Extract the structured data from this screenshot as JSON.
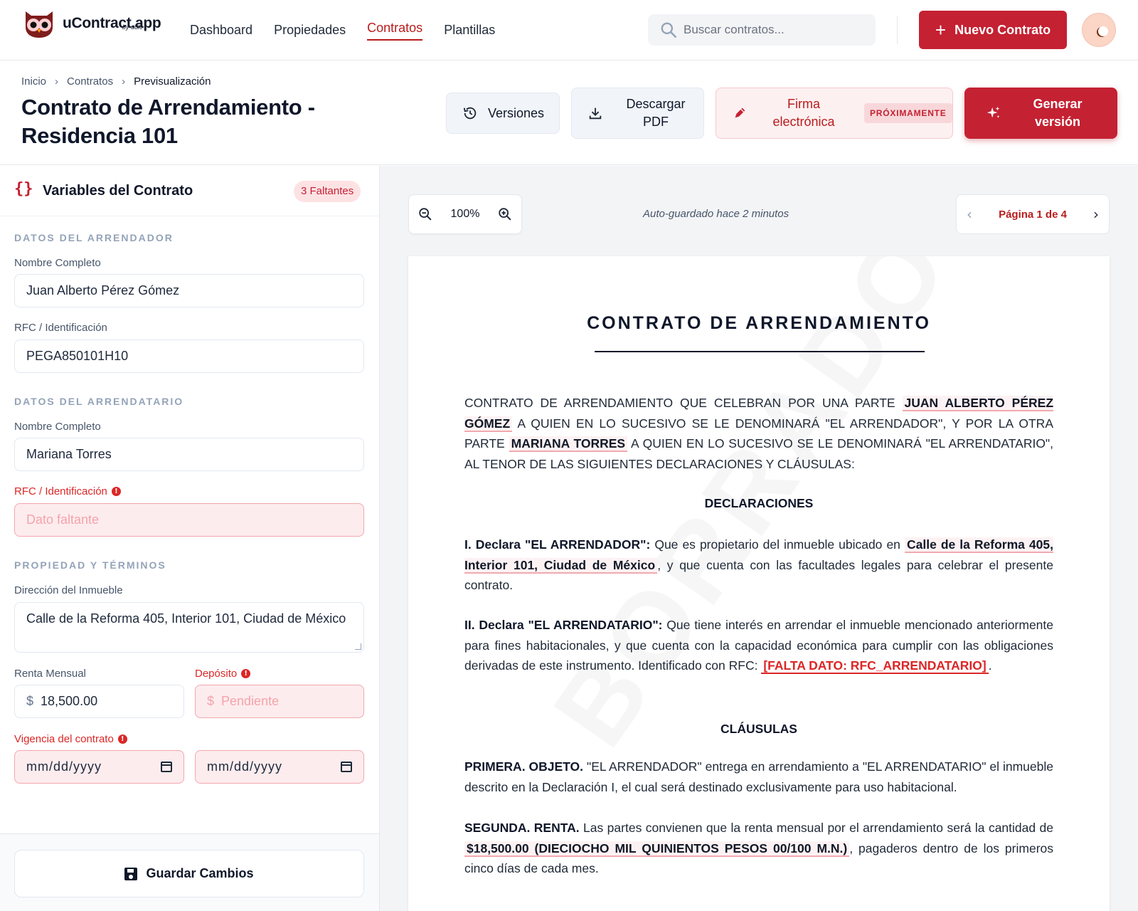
{
  "app": {
    "brand": "uContract.app",
    "brand_sub": "by uble",
    "nav": [
      "Dashboard",
      "Propiedades",
      "Contratos",
      "Plantillas"
    ],
    "active_nav": "Contratos",
    "search_placeholder": "Buscar contratos...",
    "new_button": "Nuevo Contrato",
    "accent": "#c42132"
  },
  "page": {
    "breadcrumb": [
      "Inicio",
      "Contratos",
      "Previsualización"
    ],
    "title": "Contrato de Arrendamiento - Residencia 101",
    "btn_versions": "Versiones",
    "btn_pdf": "Descargar PDF",
    "btn_sign": "Firma electrónica",
    "btn_sign_badge": "PRÓXIMAMENTE",
    "btn_generate": "Generar versión"
  },
  "panel": {
    "title": "Variables del Contrato",
    "missing_badge": "3 Faltantes",
    "sec_arrendador": "DATOS DEL ARRENDADOR",
    "sec_arrendatario": "DATOS DEL ARRENDATARIO",
    "sec_propiedad": "PROPIEDAD Y TÉRMINOS",
    "lbl_nombre": "Nombre Completo",
    "lbl_rfc": "RFC / Identificación",
    "arrendador_nombre": "Juan Alberto Pérez Gómez",
    "arrendador_rfc": "PEGA850101H10",
    "arrendatario_nombre": "Mariana Torres",
    "arrendatario_rfc_placeholder": "Dato faltante",
    "lbl_direccion": "Dirección del Inmueble",
    "direccion": "Calle de la Reforma 405, Interior 101, Ciudad de México",
    "lbl_renta": "Renta Mensual",
    "currency": "$",
    "renta": "18,500.00",
    "lbl_deposito": "Depósito",
    "deposito_placeholder": "Pendiente",
    "lbl_vigencia": "Vigencia del contrato",
    "date_placeholder": "mm/dd/yyyy",
    "save_button": "Guardar Cambios"
  },
  "viewer": {
    "zoom": "100%",
    "autosave": "Auto-guardado hace 2 minutos",
    "page": "Página 1 de 4",
    "watermark": "BORRADOR"
  },
  "doc": {
    "title": "CONTRATO DE ARRENDAMIENTO",
    "intro_1": "CONTRATO DE ARRENDAMIENTO QUE CELEBRAN POR UNA PARTE",
    "arrendador": "JUAN ALBERTO PÉREZ GÓMEZ",
    "intro_2": "A QUIEN EN LO SUCESIVO SE LE DENOMINARÁ \"EL ARRENDADOR\", Y POR LA OTRA PARTE",
    "arrendatario": "MARIANA TORRES",
    "intro_3": "A QUIEN EN LO SUCESIVO SE LE DENOMINARÁ \"EL ARRENDATARIO\", AL TENOR DE LAS SIGUIENTES DECLARACIONES Y CLÁUSULAS:",
    "h_declaraciones": "DECLARACIONES",
    "decl1_label": "I. Declara \"EL ARRENDADOR\":",
    "decl1_a": "Que es propietario del inmueble ubicado en",
    "decl1_dir": "Calle de la Reforma 405, Interior 101, Ciudad de México",
    "decl1_b": ", y que cuenta con las facultades legales para celebrar el presente contrato.",
    "decl2_label": "II. Declara \"EL ARRENDATARIO\":",
    "decl2_a": "Que tiene interés en arrendar el inmueble mencionado anteriormente para fines habitacionales, y que cuenta con la capacidad económica para cumplir con las obligaciones derivadas de este instrumento. Identificado con RFC:",
    "decl2_missing": "[FALTA DATO: RFC_ARRENDATARIO]",
    "decl2_b": ".",
    "h_clausulas": "CLÁUSULAS",
    "cl1_label": "PRIMERA. OBJETO.",
    "cl1_text": "\"EL ARRENDADOR\" entrega en arrendamiento a \"EL ARRENDATARIO\" el inmueble descrito en la Declaración I, el cual será destinado exclusivamente para uso habitacional.",
    "cl2_label": "SEGUNDA. RENTA.",
    "cl2_a": "Las partes convienen que la renta mensual por el arrendamiento será la cantidad de",
    "cl2_amount": "$18,500.00 (DIECIOCHO MIL QUINIENTOS PESOS 00/100 M.N.)",
    "cl2_b": ", pagaderos dentro de los primeros cinco días de cada mes."
  }
}
